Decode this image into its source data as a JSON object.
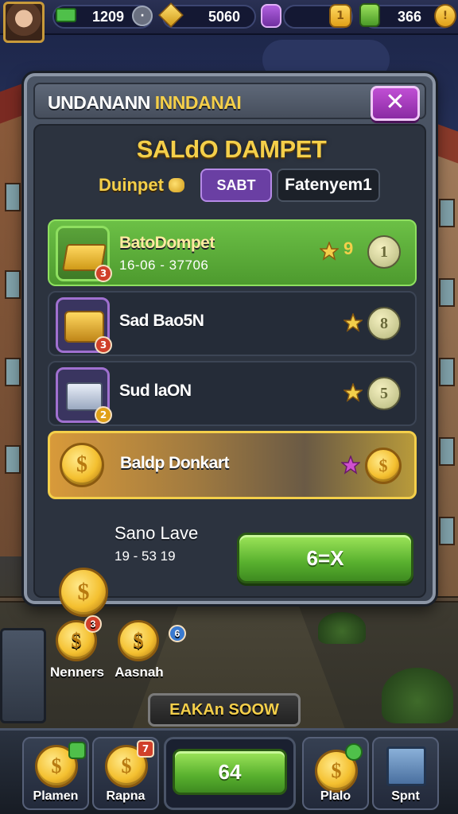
{
  "topbar": {
    "resource_1": {
      "value": "1209",
      "icon": "green-cash-icon"
    },
    "resource_2": {
      "value": "5060",
      "icon": "gold-bars-icon"
    },
    "resource_3": {
      "value": "1",
      "icon": "purple-gem-icon"
    },
    "resource_4": {
      "value": "366",
      "icon": "green-energy-icon"
    }
  },
  "panel": {
    "title_main": "UNDANANN ",
    "title_accent": "INNDANAI",
    "close_label": "✕",
    "subtitle": "SALdO DAMPET",
    "tabs": {
      "dompet": "Duinpet",
      "saldo": "SABT",
      "payment": "Fatenyem1"
    },
    "rows": [
      {
        "name": "BatoDompet",
        "sub": "16-06 - 37706",
        "cost": "9",
        "btn": "1",
        "badge": "3"
      },
      {
        "name": "Sad Bao5N",
        "btn": "8",
        "badge": "3"
      },
      {
        "name": "Sud laON",
        "btn": "5",
        "badge": "2"
      },
      {
        "name": "Baldp Donkart",
        "btn": "$"
      }
    ],
    "save": {
      "label": "Sano Lave",
      "sub": "19 - 53 19",
      "button": "6=X"
    }
  },
  "lower": {
    "item_1": {
      "label": "Nenners",
      "badge": "3"
    },
    "item_2": {
      "label": "Aasnah",
      "badge": "6"
    },
    "banner": "EAKAn SOOW"
  },
  "bottom_nav": {
    "item_1": {
      "label": "Plamen"
    },
    "item_2": {
      "label": "Rapna",
      "badge": "7"
    },
    "center": "64",
    "item_3": {
      "label": "Plalo"
    },
    "item_4": {
      "label": "Spnt"
    }
  },
  "colors": {
    "accent_gold": "#f4cf4a",
    "close_purple": "#a03ac0",
    "green": "#58b02e"
  }
}
